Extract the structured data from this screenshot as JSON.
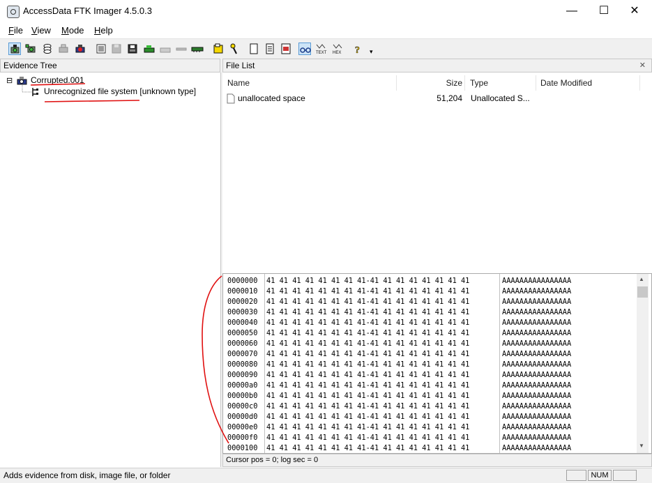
{
  "window": {
    "title": "AccessData FTK Imager 4.5.0.3",
    "min_symbol": "—",
    "max_symbol": "☐",
    "close_symbol": "✕"
  },
  "menu": [
    {
      "id": "file",
      "first": "F",
      "rest": "ile"
    },
    {
      "id": "view",
      "first": "V",
      "rest": "iew"
    },
    {
      "id": "mode",
      "first": "M",
      "rest": "ode"
    },
    {
      "id": "help",
      "first": "H",
      "rest": "elp"
    }
  ],
  "toolbar": {
    "icons": [
      "add-evidence-icon",
      "add-all-evidence-icon",
      "image-mounting-icon",
      "remove-evidence-icon",
      "remove-all-evidence-icon",
      "create-disk-image-icon",
      "export-disk-image-icon",
      "export-files-icon",
      "export-file-hash-list-icon",
      "add-to-custom-content-icon",
      "create-custom-content-image-icon",
      "capture-memory-icon",
      "obtain-protected-files-icon",
      "detect-encryption-icon",
      "hex-view-auto-icon",
      "text-view-icon",
      "hex-view-icon",
      "help-icon",
      "toolbar-dropdown-icon"
    ],
    "text_label": "TEXT",
    "hex_label": "HEX",
    "dropdown_glyph": "▾"
  },
  "evidence_tree": {
    "header": "Evidence Tree",
    "root": {
      "label": "Corrupted.001",
      "expander": "⊟"
    },
    "child": {
      "label": "Unrecognized file system [unknown type]"
    }
  },
  "file_list": {
    "header": "File List",
    "close_glyph": "✕",
    "columns": {
      "name": "Name",
      "size": "Size",
      "type": "Type",
      "date": "Date Modified"
    },
    "rows": [
      {
        "name": "unallocated space",
        "size": "51,204",
        "type": "Unallocated S...",
        "date": ""
      }
    ]
  },
  "hex_view": {
    "rows": [
      {
        "offset": "0000000",
        "bytes": "41 41 41 41 41 41 41 41-41 41 41 41 41 41 41 41",
        "ascii": "AAAAAAAAAAAAAAAA"
      },
      {
        "offset": "0000010",
        "bytes": "41 41 41 41 41 41 41 41-41 41 41 41 41 41 41 41",
        "ascii": "AAAAAAAAAAAAAAAA"
      },
      {
        "offset": "0000020",
        "bytes": "41 41 41 41 41 41 41 41-41 41 41 41 41 41 41 41",
        "ascii": "AAAAAAAAAAAAAAAA"
      },
      {
        "offset": "0000030",
        "bytes": "41 41 41 41 41 41 41 41-41 41 41 41 41 41 41 41",
        "ascii": "AAAAAAAAAAAAAAAA"
      },
      {
        "offset": "0000040",
        "bytes": "41 41 41 41 41 41 41 41-41 41 41 41 41 41 41 41",
        "ascii": "AAAAAAAAAAAAAAAA"
      },
      {
        "offset": "0000050",
        "bytes": "41 41 41 41 41 41 41 41-41 41 41 41 41 41 41 41",
        "ascii": "AAAAAAAAAAAAAAAA"
      },
      {
        "offset": "0000060",
        "bytes": "41 41 41 41 41 41 41 41-41 41 41 41 41 41 41 41",
        "ascii": "AAAAAAAAAAAAAAAA"
      },
      {
        "offset": "0000070",
        "bytes": "41 41 41 41 41 41 41 41-41 41 41 41 41 41 41 41",
        "ascii": "AAAAAAAAAAAAAAAA"
      },
      {
        "offset": "0000080",
        "bytes": "41 41 41 41 41 41 41 41-41 41 41 41 41 41 41 41",
        "ascii": "AAAAAAAAAAAAAAAA"
      },
      {
        "offset": "0000090",
        "bytes": "41 41 41 41 41 41 41 41-41 41 41 41 41 41 41 41",
        "ascii": "AAAAAAAAAAAAAAAA"
      },
      {
        "offset": "00000a0",
        "bytes": "41 41 41 41 41 41 41 41-41 41 41 41 41 41 41 41",
        "ascii": "AAAAAAAAAAAAAAAA"
      },
      {
        "offset": "00000b0",
        "bytes": "41 41 41 41 41 41 41 41-41 41 41 41 41 41 41 41",
        "ascii": "AAAAAAAAAAAAAAAA"
      },
      {
        "offset": "00000c0",
        "bytes": "41 41 41 41 41 41 41 41-41 41 41 41 41 41 41 41",
        "ascii": "AAAAAAAAAAAAAAAA"
      },
      {
        "offset": "00000d0",
        "bytes": "41 41 41 41 41 41 41 41-41 41 41 41 41 41 41 41",
        "ascii": "AAAAAAAAAAAAAAAA"
      },
      {
        "offset": "00000e0",
        "bytes": "41 41 41 41 41 41 41 41-41 41 41 41 41 41 41 41",
        "ascii": "AAAAAAAAAAAAAAAA"
      },
      {
        "offset": "00000f0",
        "bytes": "41 41 41 41 41 41 41 41-41 41 41 41 41 41 41 41",
        "ascii": "AAAAAAAAAAAAAAAA"
      },
      {
        "offset": "0000100",
        "bytes": "41 41 41 41 41 41 41 41-41 41 41 41 41 41 41 41",
        "ascii": "AAAAAAAAAAAAAAAA"
      }
    ],
    "cursor_status": "Cursor pos = 0; log sec = 0",
    "scroll_up": "▲",
    "scroll_down": "▼"
  },
  "statusbar": {
    "text": "Adds evidence from disk, image file, or folder",
    "num": "NUM"
  },
  "colors": {
    "annotation": "#e01010",
    "pressed_bg": "#cde4f7",
    "pressed_border": "#5a9bd5",
    "chrome": "#f0f0f0"
  }
}
